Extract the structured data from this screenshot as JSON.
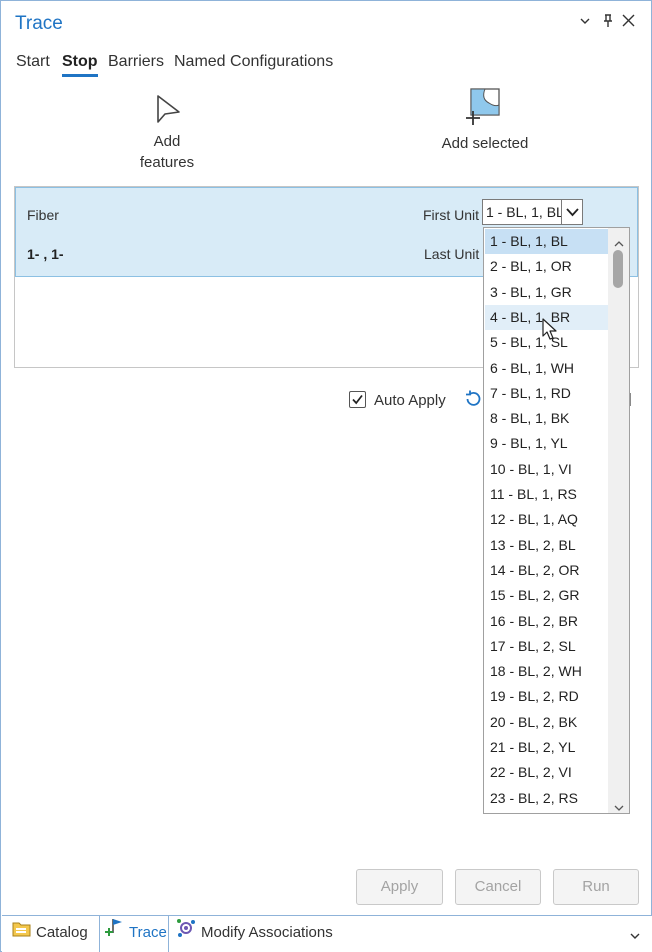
{
  "pane": {
    "title": "Trace",
    "controls": {
      "dropdown": "▾",
      "pin": "⊥",
      "close": "✕"
    }
  },
  "tabs": [
    "Start",
    "Stop",
    "Barriers",
    "Named Configurations"
  ],
  "tools": {
    "add_features": {
      "line1": "Add",
      "line2": "features"
    },
    "add_selected": {
      "label": "Add selected"
    }
  },
  "stop_list": {
    "row_title": "Fiber",
    "row_value": "1- , 1-",
    "first_unit_label": "First Unit",
    "last_unit_label": "Last Unit",
    "first_unit_value": "1 - BL, 1, BL",
    "options": [
      "1 - BL, 1, BL",
      "2 - BL, 1, OR",
      "3 - BL, 1, GR",
      "4 - BL, 1, BR",
      "5 - BL, 1, SL",
      "6 - BL, 1, WH",
      "7 - BL, 1, RD",
      "8 - BL, 1, BK",
      "9 - BL, 1, YL",
      "10 - BL, 1, VI",
      "11 - BL, 1, RS",
      "12 - BL, 1, AQ",
      "13 - BL, 2, BL",
      "14 - BL, 2, OR",
      "15 - BL, 2, GR",
      "16 - BL, 2, BR",
      "17 - BL, 2, SL",
      "18 - BL, 2, WH",
      "19 - BL, 2, RD",
      "20 - BL, 2, BK",
      "21 - BL, 2, YL",
      "22 - BL, 2, VI",
      "23 - BL, 2, RS"
    ],
    "selected_index": 0,
    "hover_index": 3
  },
  "auto_apply": {
    "label": "Auto Apply",
    "checked": true
  },
  "buttons": {
    "apply": "Apply",
    "cancel": "Cancel",
    "run": "Run"
  },
  "bottom_tabs": {
    "catalog": "Catalog",
    "trace": "Trace",
    "modify": "Modify Associations"
  },
  "colors": {
    "accent": "#1f74c4",
    "selection": "#d8ebf7",
    "option_selected": "#c7e0f4"
  }
}
